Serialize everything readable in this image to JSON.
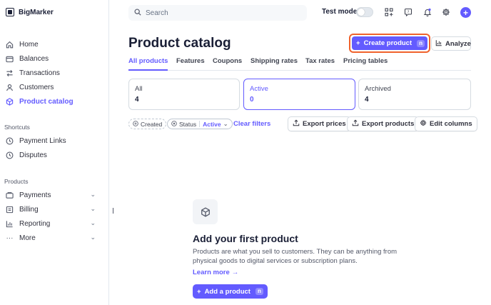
{
  "brand": {
    "name": "BigMarker"
  },
  "sidebar": {
    "main": [
      {
        "label": "Home",
        "icon": "home-icon"
      },
      {
        "label": "Balances",
        "icon": "balances-icon"
      },
      {
        "label": "Transactions",
        "icon": "transactions-icon"
      },
      {
        "label": "Customers",
        "icon": "customers-icon"
      },
      {
        "label": "Product catalog",
        "icon": "product-catalog-icon",
        "active": true
      }
    ],
    "shortcuts_title": "Shortcuts",
    "shortcuts": [
      {
        "label": "Payment Links",
        "icon": "clock-icon"
      },
      {
        "label": "Disputes",
        "icon": "clock-icon"
      }
    ],
    "products_title": "Products",
    "products": [
      {
        "label": "Payments",
        "icon": "payments-icon"
      },
      {
        "label": "Billing",
        "icon": "billing-icon"
      },
      {
        "label": "Reporting",
        "icon": "reporting-icon"
      },
      {
        "label": "More",
        "icon": "more-icon"
      }
    ]
  },
  "topbar": {
    "search_placeholder": "Search",
    "test_mode_label": "Test mode",
    "test_mode_on": false
  },
  "header": {
    "title": "Product catalog",
    "create_label": "Create product",
    "create_shortcut": "n",
    "analyze_label": "Analyze"
  },
  "tabs": [
    "All products",
    "Features",
    "Coupons",
    "Shipping rates",
    "Tax rates",
    "Pricing tables"
  ],
  "active_tab": "All products",
  "status_cards": [
    {
      "label": "All",
      "count": "4"
    },
    {
      "label": "Active",
      "count": "0",
      "active": true
    },
    {
      "label": "Archived",
      "count": "4"
    }
  ],
  "filters": {
    "created_label": "Created",
    "status_label": "Status",
    "status_value": "Active",
    "clear_label": "Clear filters"
  },
  "toolbar": {
    "export_prices": "Export prices",
    "export_products": "Export products",
    "edit_columns": "Edit columns"
  },
  "empty_state": {
    "title": "Add your first product",
    "description": "Products are what you sell to customers. They can be anything from physical goods to digital services or subscription plans.",
    "learn_more": "Learn more",
    "add_label": "Add a product",
    "add_shortcut": "n"
  },
  "colors": {
    "accent": "#635bff",
    "highlight": "#f0622c"
  }
}
